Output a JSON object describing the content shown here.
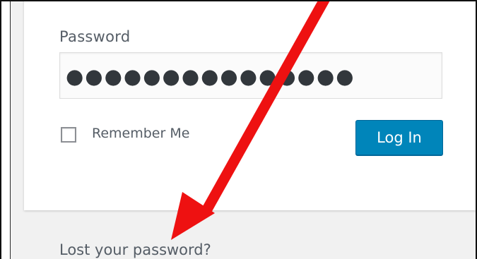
{
  "login_form": {
    "password_label": "Password",
    "password_value": "●●●●●●●●●●●●●●●",
    "remember_label": "Remember Me",
    "remember_checked": false,
    "login_button_label": "Log In"
  },
  "links": {
    "lost_password": "Lost your password?"
  },
  "colors": {
    "button_bg": "#0085ba",
    "text": "#555d66",
    "page_bg": "#f1f1f1",
    "annotation_arrow": "#ee1111"
  },
  "annotation": {
    "icon": "red-arrow-icon"
  }
}
